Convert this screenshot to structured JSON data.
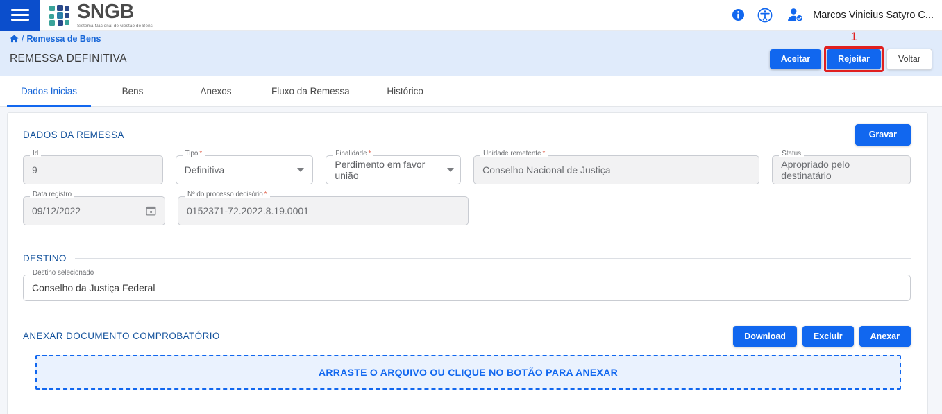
{
  "header": {
    "menu_icon": "hamburger-icon",
    "brand_name": "SNGB",
    "brand_tagline": "Sistema Nacional de Gestão de Bens",
    "info_icon": "info-icon",
    "accessibility_icon": "accessibility-icon",
    "avatar_icon": "user-avatar-icon",
    "user_name": "Marcos Vinicius Satyro C..."
  },
  "breadcrumb": {
    "home_icon": "home-icon",
    "separator": "/",
    "current": "Remessa de Bens"
  },
  "page": {
    "title": "REMESSA DEFINITIVA",
    "actions": {
      "accept": "Aceitar",
      "reject": "Rejeitar",
      "back": "Voltar"
    },
    "annotation_number": "1"
  },
  "tabs": [
    {
      "label": "Dados Inicias",
      "active": true
    },
    {
      "label": "Bens",
      "active": false
    },
    {
      "label": "Anexos",
      "active": false
    },
    {
      "label": "Fluxo da Remessa",
      "active": false
    },
    {
      "label": "Histórico",
      "active": false
    }
  ],
  "dados_remessa": {
    "section_title": "DADOS DA REMESSA",
    "save_label": "Gravar",
    "fields": {
      "id": {
        "label": "Id",
        "value": "9",
        "required": false
      },
      "tipo": {
        "label": "Tipo",
        "value": "Definitiva",
        "required": true
      },
      "finalidade": {
        "label": "Finalidade",
        "value": "Perdimento em favor união",
        "required": true
      },
      "unidade_remetente": {
        "label": "Unidade remetente",
        "value": "Conselho Nacional de Justiça",
        "required": true
      },
      "status": {
        "label": "Status",
        "value": "Apropriado pelo destinatário",
        "required": false
      },
      "data_registro": {
        "label": "Data registro",
        "value": "09/12/2022",
        "required": false
      },
      "processo": {
        "label": "Nº do processo decisório",
        "value": "0152371-72.2022.8.19.0001",
        "required": true
      }
    }
  },
  "destino": {
    "section_title": "DESTINO",
    "field": {
      "label": "Destino selecionado",
      "value": "Conselho da Justiça Federal"
    }
  },
  "anexar": {
    "section_title": "ANEXAR DOCUMENTO COMPROBATÓRIO",
    "buttons": {
      "download": "Download",
      "delete": "Excluir",
      "attach": "Anexar"
    },
    "dropzone_text": "ARRASTE O ARQUIVO OU CLIQUE NO BOTÃO PARA ANEXAR"
  },
  "colors": {
    "primary_blue": "#1167ef",
    "menu_blue": "#0b4ecc",
    "band_blue": "#e0ebfb",
    "section_title": "#13529c",
    "link_blue": "#1565d8",
    "highlight_red": "#e02020",
    "required_red": "#e0614c",
    "logo_teal": "#2a9d8f",
    "logo_navy": "#2b4a8b"
  },
  "required_marker": "*"
}
